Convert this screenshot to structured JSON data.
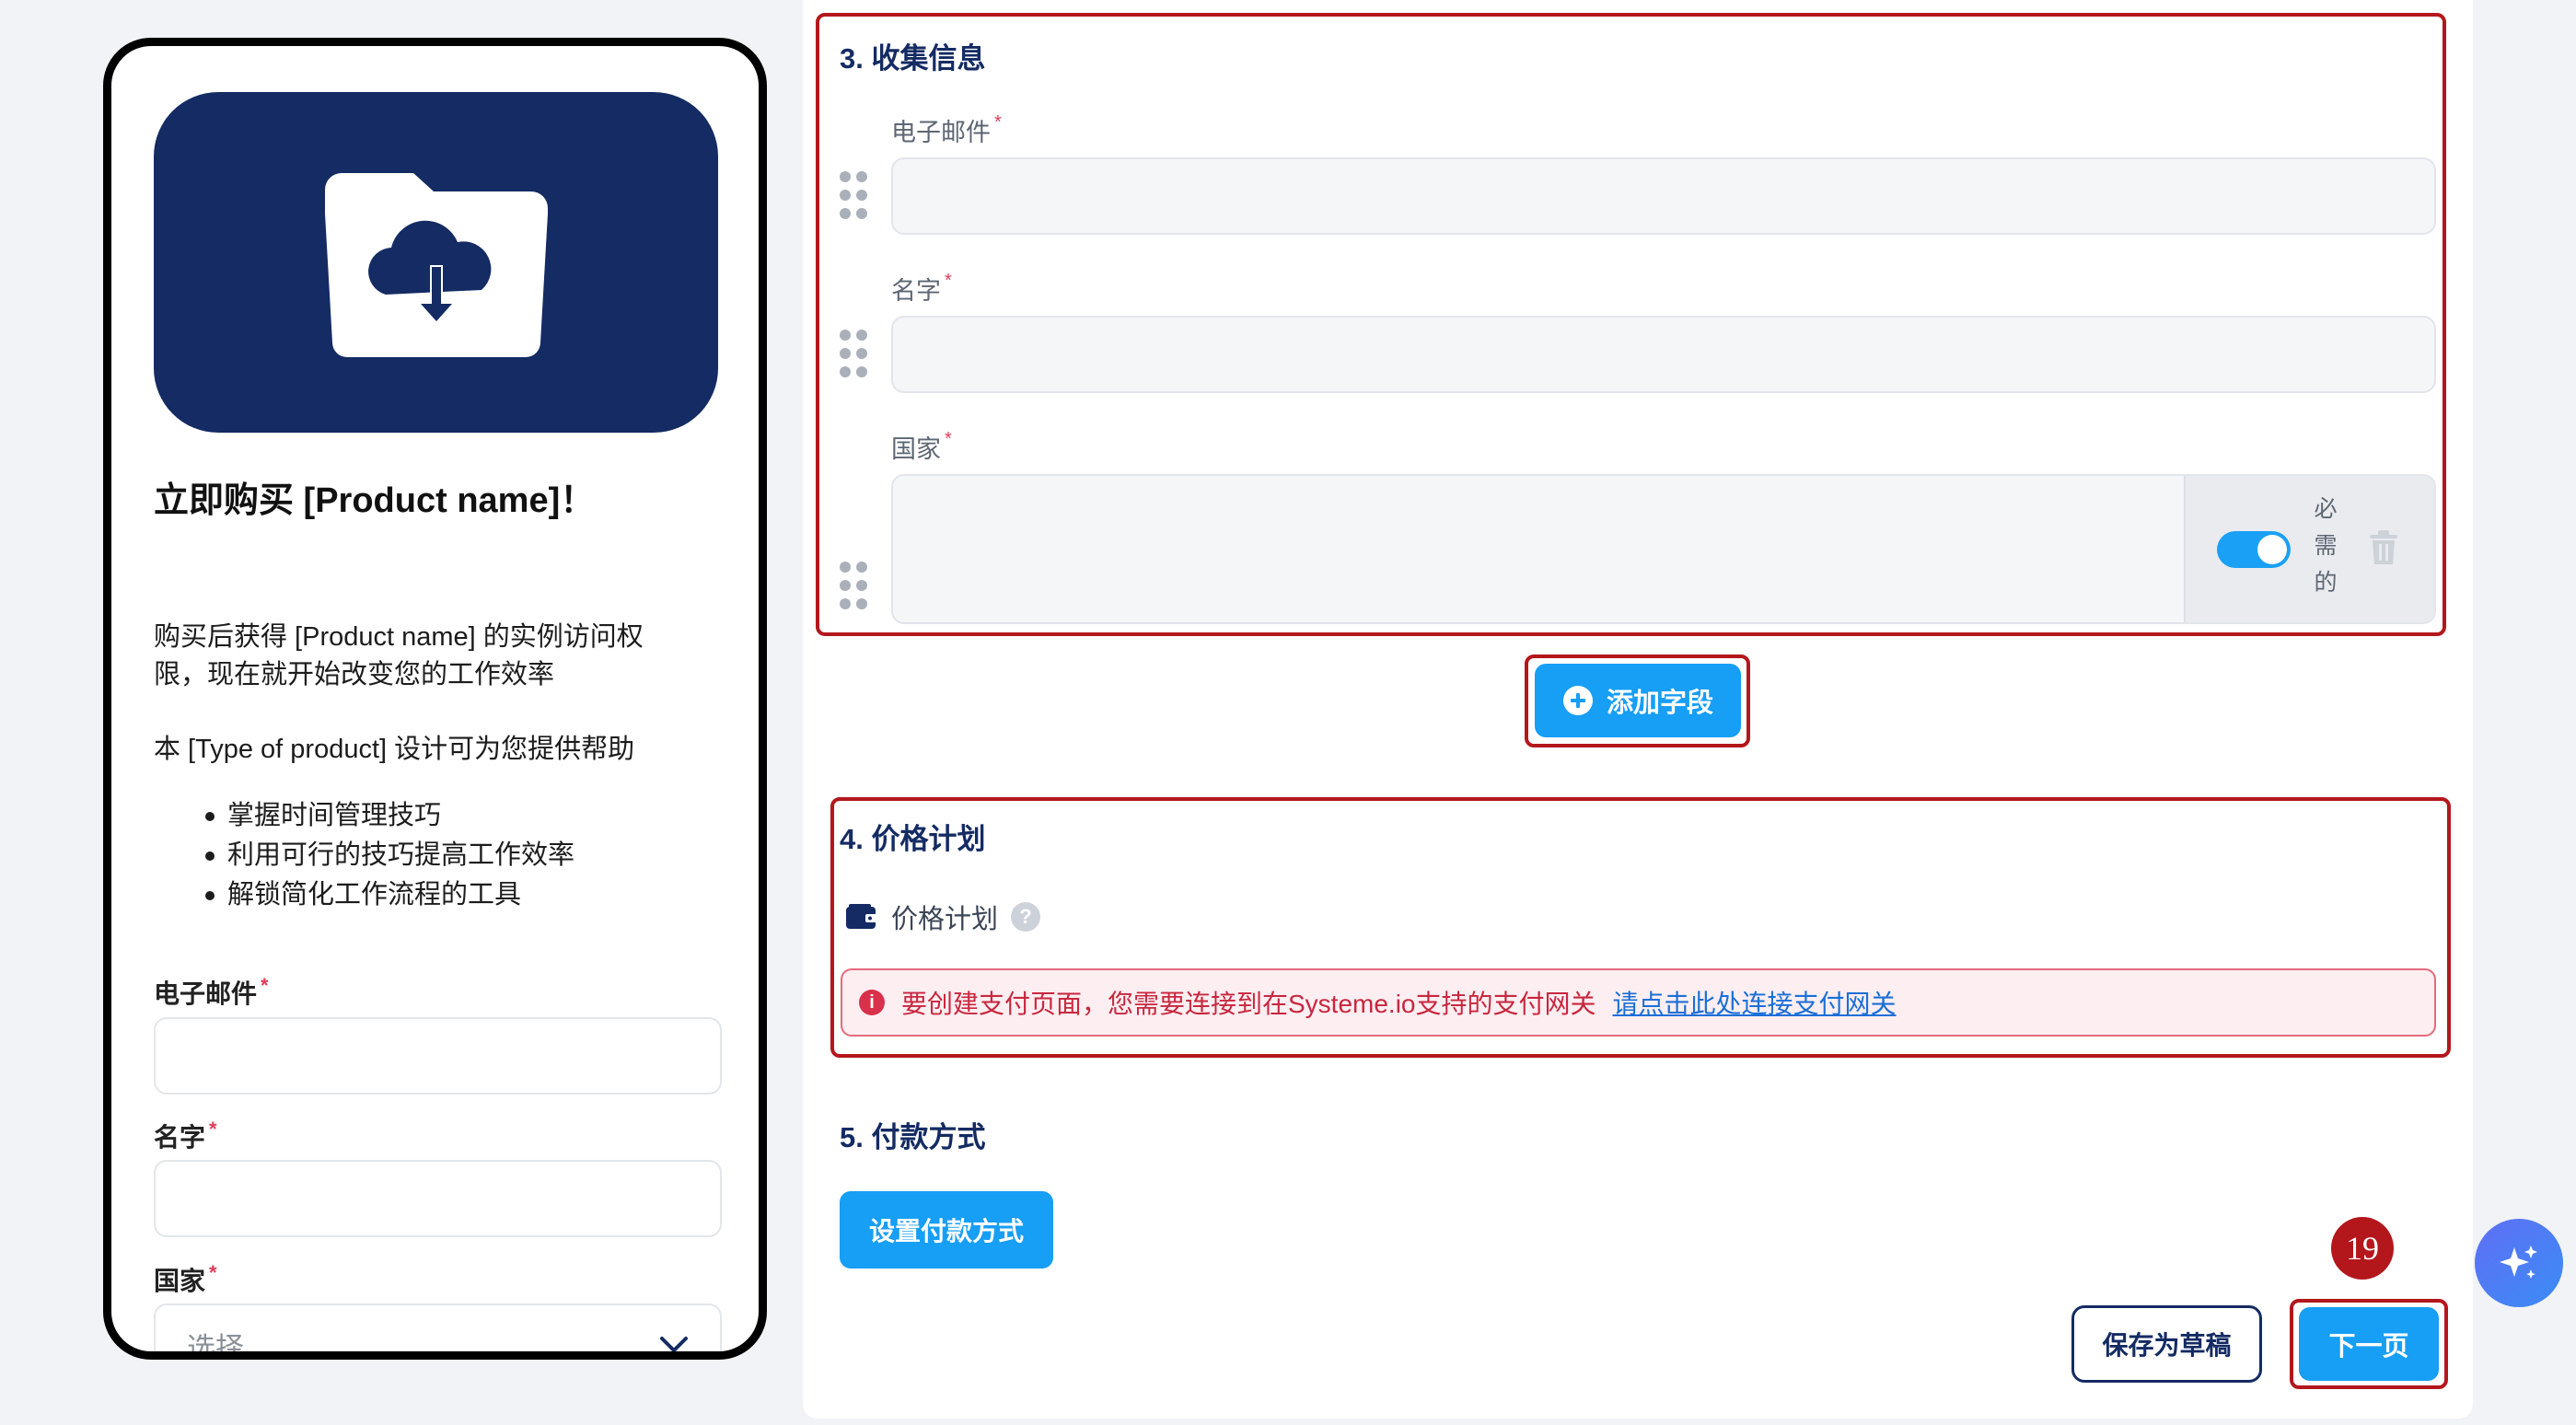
{
  "preview": {
    "title": "立即购买 [Product name]！",
    "desc1": "购买后获得 [Product name] 的实例访问权",
    "desc2": "限，现在就开始改变您的工作效率",
    "desc3": "本 [Type of product] 设计可为您提供帮助",
    "bullets": [
      "掌握时间管理技巧",
      "利用可行的技巧提高工作效率",
      "解锁简化工作流程的工具"
    ],
    "fields": {
      "email_label": "电子邮件",
      "name_label": "名字",
      "country_label": "国家",
      "country_placeholder": "选择",
      "required_mark": "*"
    },
    "hero_icon": "folder-cloud-download-icon"
  },
  "editor": {
    "collect": {
      "title": "3. 收集信息",
      "email_label": "电子邮件",
      "name_label": "名字",
      "country_label": "国家",
      "required_word": [
        "必",
        "需",
        "的"
      ],
      "add_field": "添加字段"
    },
    "pricing": {
      "title": "4. 价格计划",
      "plan_label": "价格计划",
      "help": "?",
      "alert_text": "要创建支付页面，您需要连接到在Systeme.io支持的支付网关",
      "alert_link": "请点击此处连接支付网关"
    },
    "payment": {
      "title": "5. 付款方式",
      "setup_button": "设置付款方式"
    },
    "footer": {
      "save_draft": "保存为草稿",
      "next": "下一页"
    },
    "step_badge": "19"
  },
  "colors": {
    "navy": "#142b63",
    "primary": "#179ef5",
    "highlight": "#b3171c",
    "error": "#c8273f"
  }
}
